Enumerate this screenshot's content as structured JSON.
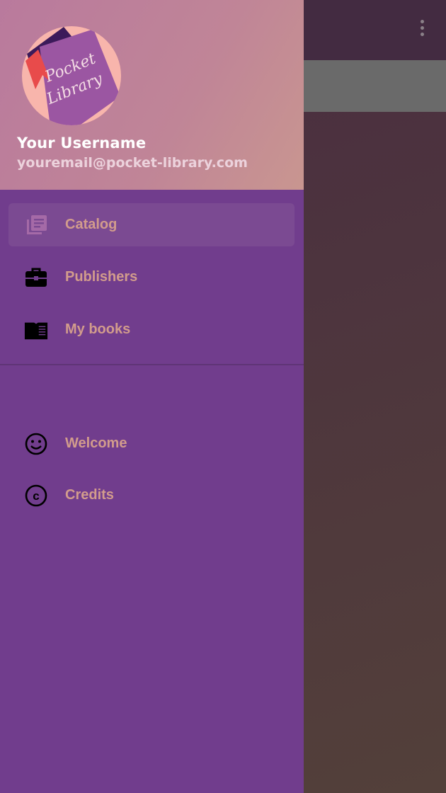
{
  "header": {
    "logo_text": "Pocket Library",
    "username": "Your Username",
    "email": "youremail@pocket-library.com"
  },
  "nav": {
    "primary": [
      {
        "label": "Catalog",
        "icon": "library-books-icon",
        "active": true
      },
      {
        "label": "Publishers",
        "icon": "briefcase-icon",
        "active": false
      },
      {
        "label": "My books",
        "icon": "open-book-icon",
        "active": false
      }
    ],
    "secondary": [
      {
        "label": "Welcome",
        "icon": "smiley-icon"
      },
      {
        "label": "Credits",
        "icon": "copyright-icon"
      }
    ]
  },
  "colors": {
    "drawer": "#713d8d",
    "label": "#d29c8c",
    "active_bg": "#7b4a92"
  }
}
